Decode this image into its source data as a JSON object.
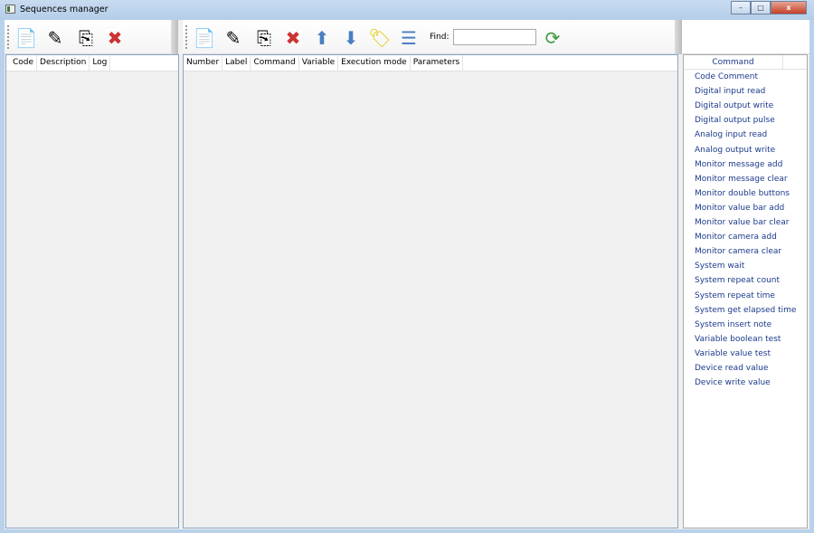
{
  "window": {
    "title": "Sequences manager",
    "minimize": "–",
    "maximize": "□",
    "close": "x"
  },
  "sequences_toolbar": {
    "icons": [
      "new-sequence-icon",
      "edit-icon",
      "copy-icon",
      "delete-icon"
    ]
  },
  "sequences_table": {
    "columns": [
      "Code",
      "Description",
      "Log"
    ]
  },
  "steps_toolbar": {
    "icons": [
      "add-step-icon",
      "edit-icon",
      "copy-icon",
      "delete-icon",
      "move-up-icon",
      "move-down-icon",
      "label-tag-icon",
      "indent-icon"
    ],
    "find_label": "Find:",
    "find_value": "",
    "refresh_icon": "refresh-icon"
  },
  "steps_table": {
    "columns": [
      "Number",
      "Label",
      "Command",
      "Variable",
      "Execution mode",
      "Parameters"
    ]
  },
  "commands": {
    "header": "Command",
    "items": [
      "Code Comment",
      "Digital input read",
      "Digital output write",
      "Digital output pulse",
      "Analog input read",
      "Analog output write",
      "Monitor message add",
      "Monitor message clear",
      "Monitor double buttons",
      "Monitor value bar add",
      "Monitor value bar clear",
      "Monitor camera add",
      "Monitor camera clear",
      "System wait",
      "System repeat count",
      "System repeat time",
      "System get elapsed time",
      "System insert note",
      "Variable boolean test",
      "Variable value test",
      "Device read value",
      "Device write value"
    ]
  }
}
